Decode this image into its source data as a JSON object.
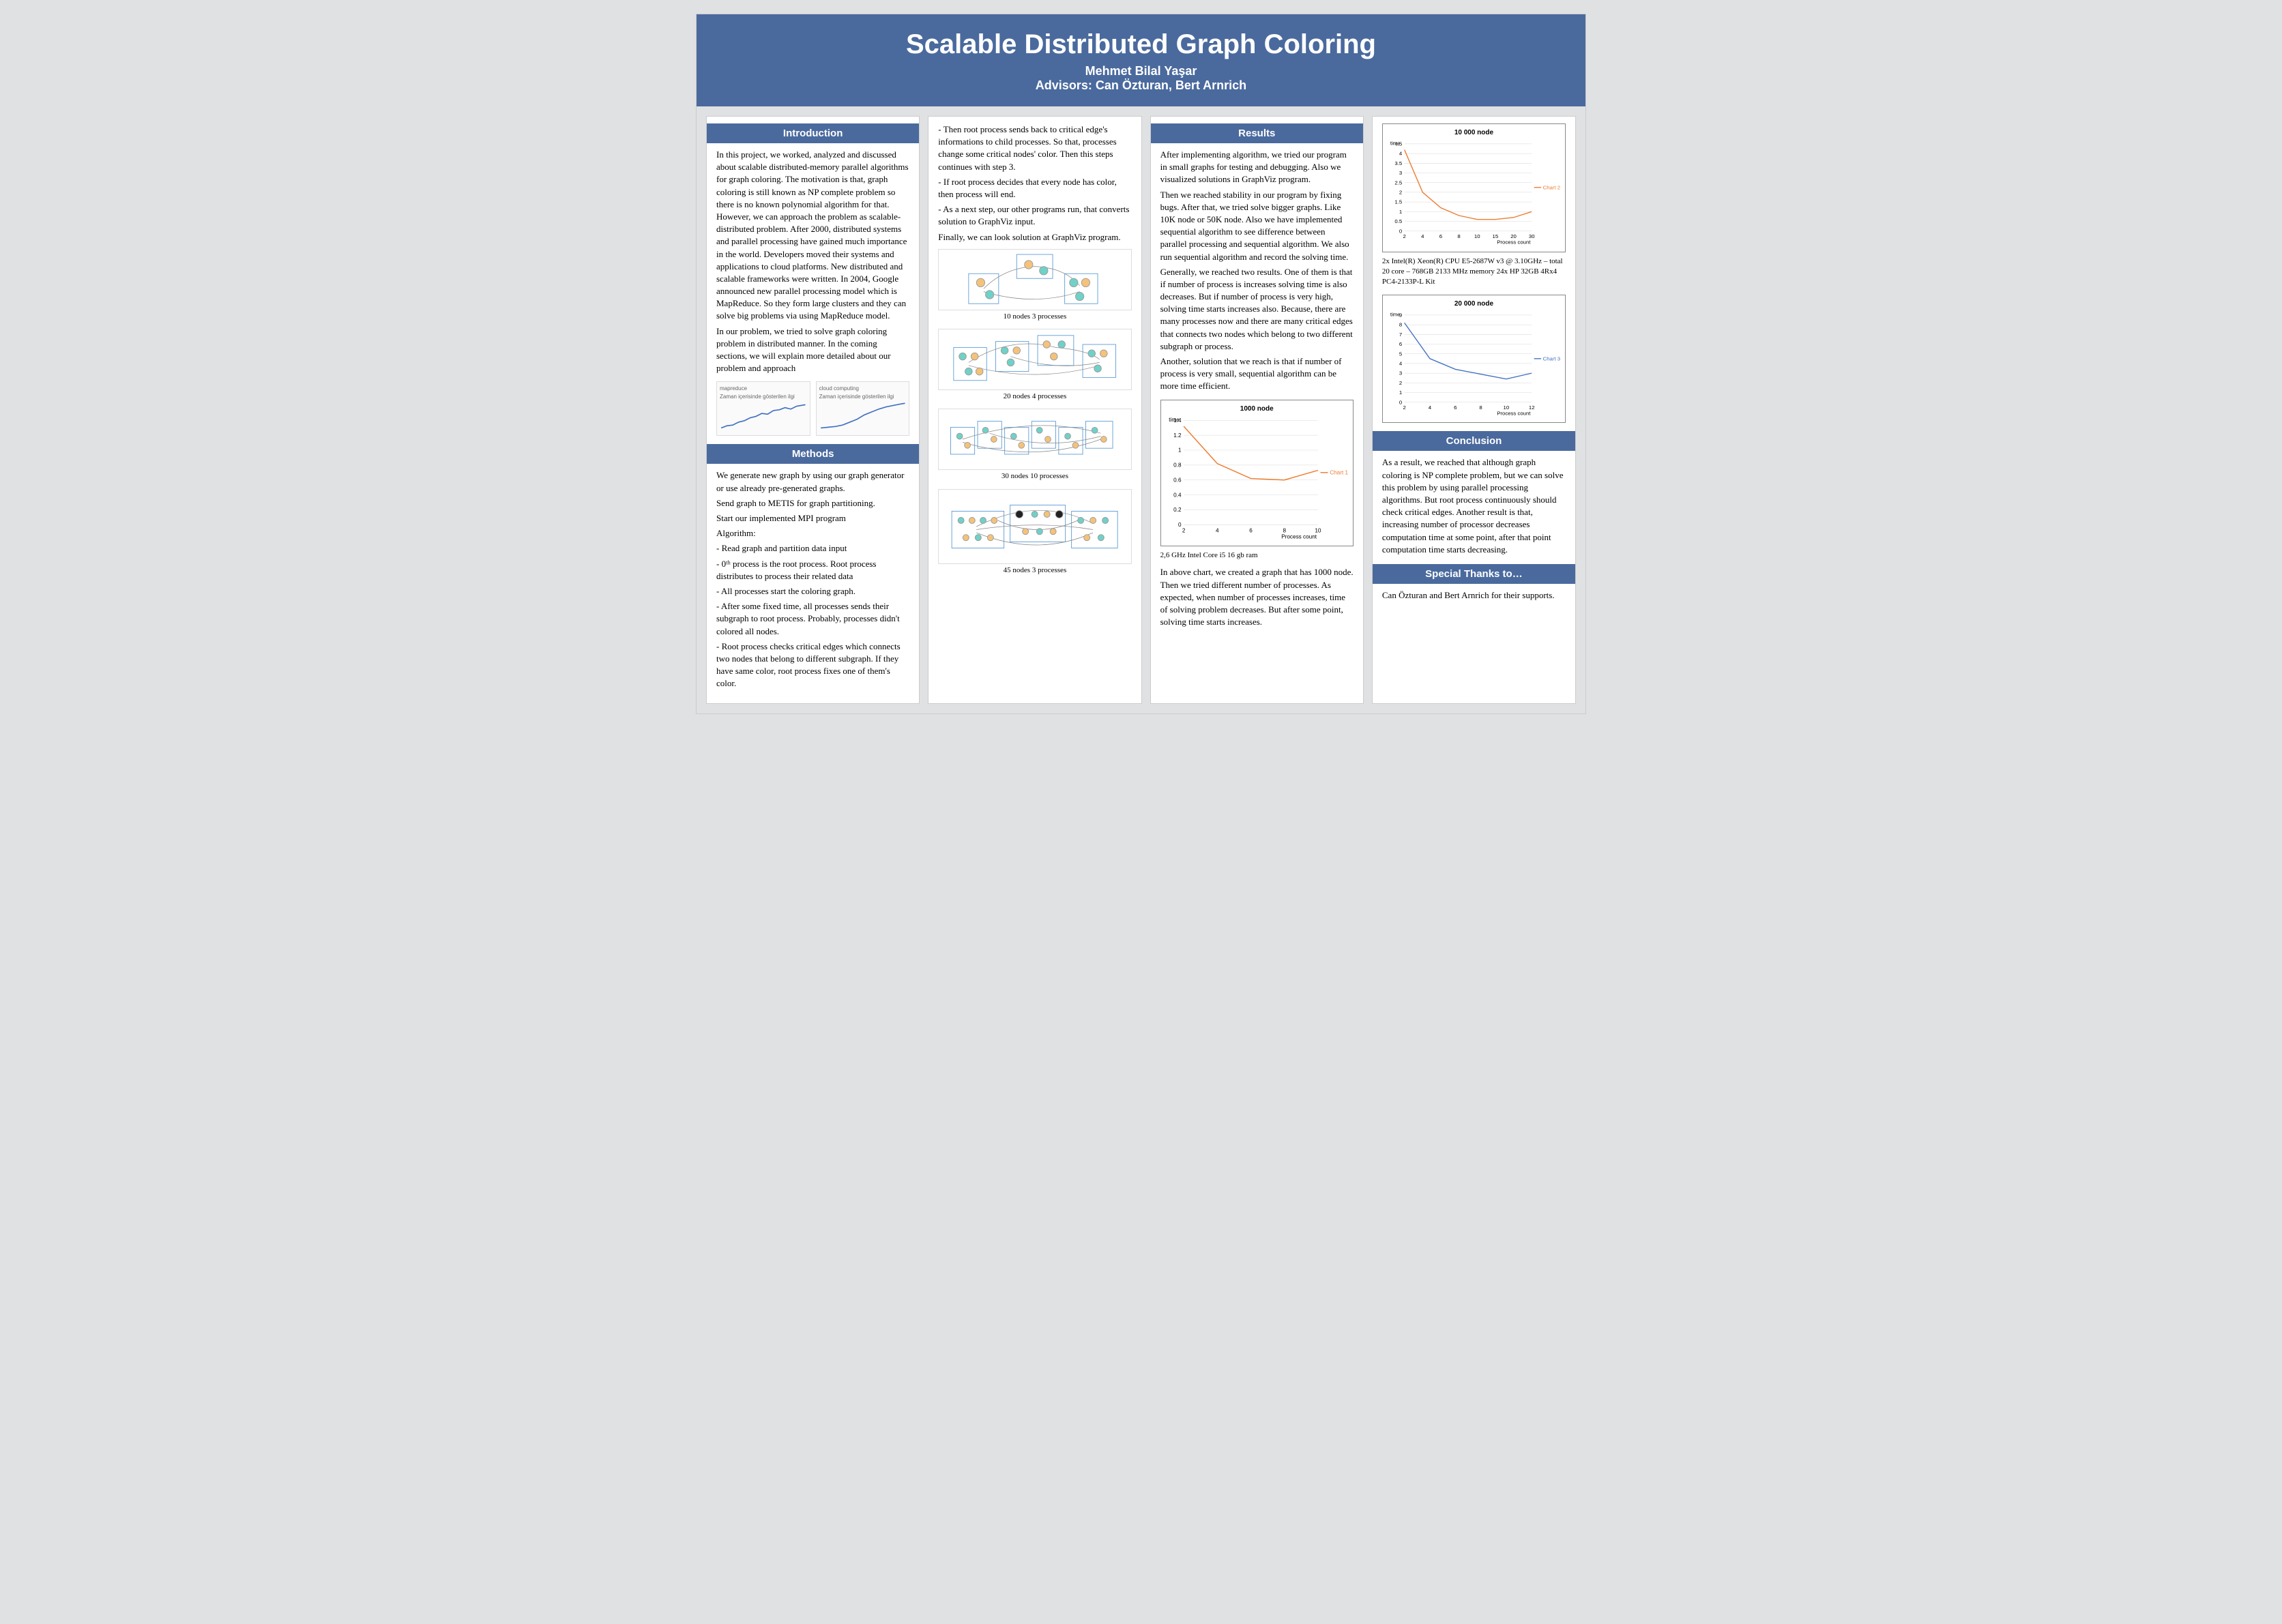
{
  "header": {
    "title": "Scalable Distributed Graph Coloring",
    "author": "Mehmet Bilal Yaşar",
    "advisors": "Advisors: Can Özturan, Bert Arnrich"
  },
  "intro": {
    "heading": "Introduction",
    "p1": "In this project, we worked, analyzed and discussed about scalable distributed-memory parallel algorithms for graph coloring. The motivation is that, graph coloring is still known as NP complete problem so there is no known polynomial algorithm for that. However, we can approach the problem as scalable-distributed problem. After 2000, distributed systems and parallel processing have gained much importance in the world. Developers moved their systems and applications to cloud platforms. New distributed and scalable frameworks were written. In 2004, Google announced new parallel processing model which is MapReduce. So they form large clusters and they can solve big problems via using MapReduce model.",
    "p2": " In our problem, we tried to solve graph coloring problem in distributed manner. In the coming sections, we will explain more detailed about our problem and approach",
    "trend_a": "mapreduce",
    "trend_b": "cloud computing",
    "trend_sub": "Zaman içerisinde gösterilen ilgi"
  },
  "methods": {
    "heading": "Methods",
    "p1": "We generate new graph by using our graph generator or use already pre-generated graphs.",
    "p2": "Send graph to METIS for graph partitioning.",
    "p3": "Start our implemented MPI program",
    "p4": "Algorithm:",
    "b1": "- Read graph and partition data input",
    "b2": "- 0ᵗʰ process is the root process. Root process distributes to process their related data",
    "b3": "- All processes start the coloring graph.",
    "b4": "- After some fixed time, all processes sends their subgraph to root process. Probably, processes didn't colored all nodes.",
    "b5": " - Root process checks critical edges which connects two nodes that belong to different subgraph. If they have same color, root process fixes one of them's color."
  },
  "col2": {
    "p1": "- Then root process sends back to critical edge's informations to child processes. So that, processes change some critical nodes' color. Then this steps continues with step 3.",
    "p2": "-  If root process decides that every node has color, then process will end.",
    "p3": "-  As a next step, our other programs run, that converts solution to GraphViz input.",
    "p4": "Finally, we can look solution at GraphViz program.",
    "cap1": "10 nodes  3 processes",
    "cap2": "20 nodes  4 processes",
    "cap3": "30 nodes 10 processes",
    "cap4": "45 nodes 3 processes"
  },
  "results": {
    "heading": "Results",
    "p1": "After implementing algorithm, we tried our program in small graphs for testing and debugging. Also we visualized solutions in GraphViz program.",
    "p2": "Then we reached stability in our program by fixing bugs. After that, we tried solve bigger graphs. Like 10K node or 50K node. Also we have implemented sequential algorithm to see difference between parallel processing and sequential algorithm. We also run sequential algorithm and record the solving time.",
    "p3": "Generally, we reached two results. One of them is that if number of process is increases  solving time is also decreases. But if number of process is very high, solving time starts increases also. Because,  there are many processes now and there are many critical edges that connects two nodes which belong to two different subgraph or process.",
    "p4": "Another, solution that we reach is that if number of process is very small, sequential algorithm can be more time efficient.",
    "spec1": "2,6 GHz Intel Core i5  16 gb ram",
    "note1": "In above chart, we created a graph that has 1000 node. Then we tried different number of processes. As expected, when number of processes increases, time of solving problem decreases. But after some point, solving time starts increases."
  },
  "col4": {
    "spec2": "2x Intel(R) Xeon(R) CPU E5-2687W v3 @ 3.10GHz – total 20 core – 768GB 2133 MHz memory 24x HP 32GB 4Rx4 PC4-2133P-L Kit"
  },
  "conclusion": {
    "heading": "Conclusion",
    "p1": "As a result, we reached that although graph coloring is NP complete problem, but we can solve this problem by using parallel processing algorithms. But root process continuously  should check critical edges. Another result is that, increasing number of processor decreases computation time at some point, after that point computation time starts decreasing."
  },
  "thanks": {
    "heading": "Special Thanks to…",
    "p1": "Can Özturan and Bert Arnrich for their supports."
  },
  "chart_data": [
    {
      "id": "chart1",
      "type": "line",
      "title": "1000 node",
      "xlabel": "Process count",
      "ylabel": "time",
      "series_name": "Chart 1",
      "color": "#ed7d31",
      "x": [
        2,
        4,
        6,
        8,
        10
      ],
      "y": [
        1.32,
        0.82,
        0.62,
        0.6,
        0.73
      ],
      "ylim": [
        0,
        1.4
      ],
      "yticks": [
        0,
        0.2,
        0.4,
        0.6,
        0.8,
        1.0,
        1.2,
        1.4
      ]
    },
    {
      "id": "chart2",
      "type": "line",
      "title": "10 000 node",
      "xlabel": "Process count",
      "ylabel": "time",
      "series_name": "Chart 2",
      "color": "#ed7d31",
      "x": [
        2,
        4,
        6,
        8,
        10,
        15,
        20,
        30
      ],
      "y": [
        4.2,
        2.0,
        1.2,
        0.8,
        0.6,
        0.6,
        0.7,
        1.0
      ],
      "ylim": [
        0,
        4.5
      ],
      "yticks": [
        0,
        0.5,
        1,
        1.5,
        2,
        2.5,
        3,
        3.5,
        4,
        4.5
      ]
    },
    {
      "id": "chart3",
      "type": "line",
      "title": "20 000 node",
      "xlabel": "Process count",
      "ylabel": "time",
      "series_name": "Chart 3",
      "color": "#4472c4",
      "x": [
        2,
        4,
        6,
        8,
        10,
        12
      ],
      "y": [
        8.2,
        4.5,
        3.4,
        2.9,
        2.4,
        3.0
      ],
      "ylim": [
        0,
        9
      ],
      "yticks": [
        0,
        1,
        2,
        3,
        4,
        5,
        6,
        7,
        8,
        9
      ]
    }
  ]
}
